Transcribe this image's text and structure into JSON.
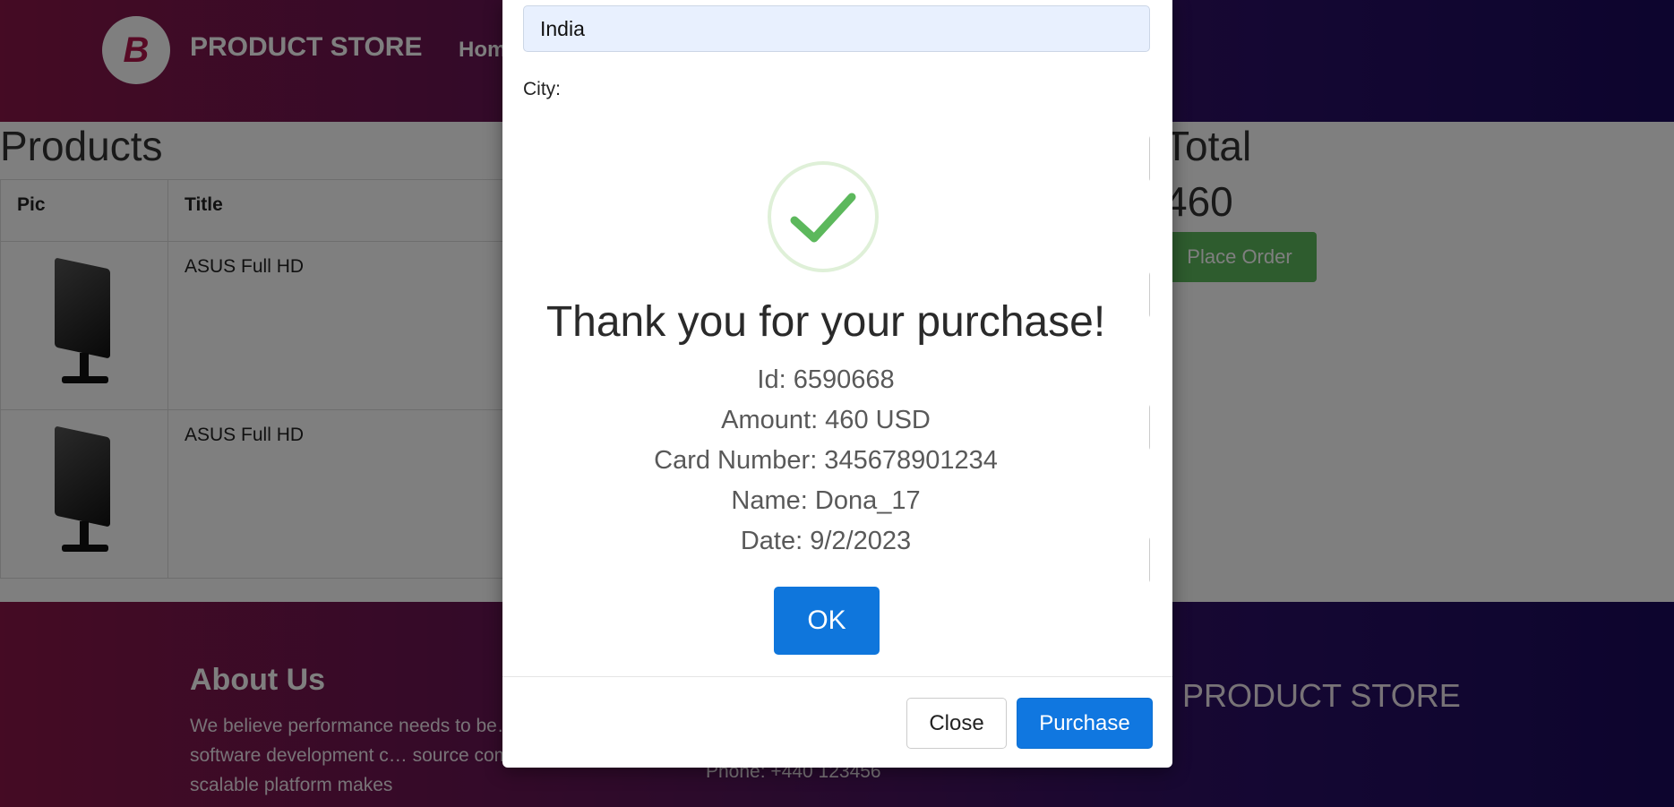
{
  "nav": {
    "brand": "PRODUCT STORE",
    "logo_letter": "B",
    "home": "Home"
  },
  "products": {
    "heading": "Products",
    "columns": [
      "Pic",
      "Title"
    ],
    "rows": [
      {
        "title": "ASUS Full HD"
      },
      {
        "title": "ASUS Full HD"
      }
    ]
  },
  "cart": {
    "total_heading": "Total",
    "total_value": "460",
    "place_order": "Place Order"
  },
  "footer": {
    "about_title": "About Us",
    "about_text": "We believe performance needs to be… stage of the software development c… source compatible, massively scalable platform makes",
    "phone": "Phone: +440 123456",
    "brand": "PRODUCT STORE"
  },
  "order_modal": {
    "country_value": "India",
    "city_label": "City:",
    "close_label": "Close",
    "purchase_label": "Purchase"
  },
  "confirmation": {
    "title": "Thank you for your purchase!",
    "lines": [
      "Id: 6590668",
      "Amount: 460 USD",
      "Card Number: 345678901234",
      "Name: Dona_17",
      "Date: 9/2/2023"
    ],
    "ok_label": "OK",
    "icon": "checkmark-icon"
  },
  "colors": {
    "primary": "#0f76dc",
    "success": "#5cb85c",
    "check": "#5cb85c"
  }
}
